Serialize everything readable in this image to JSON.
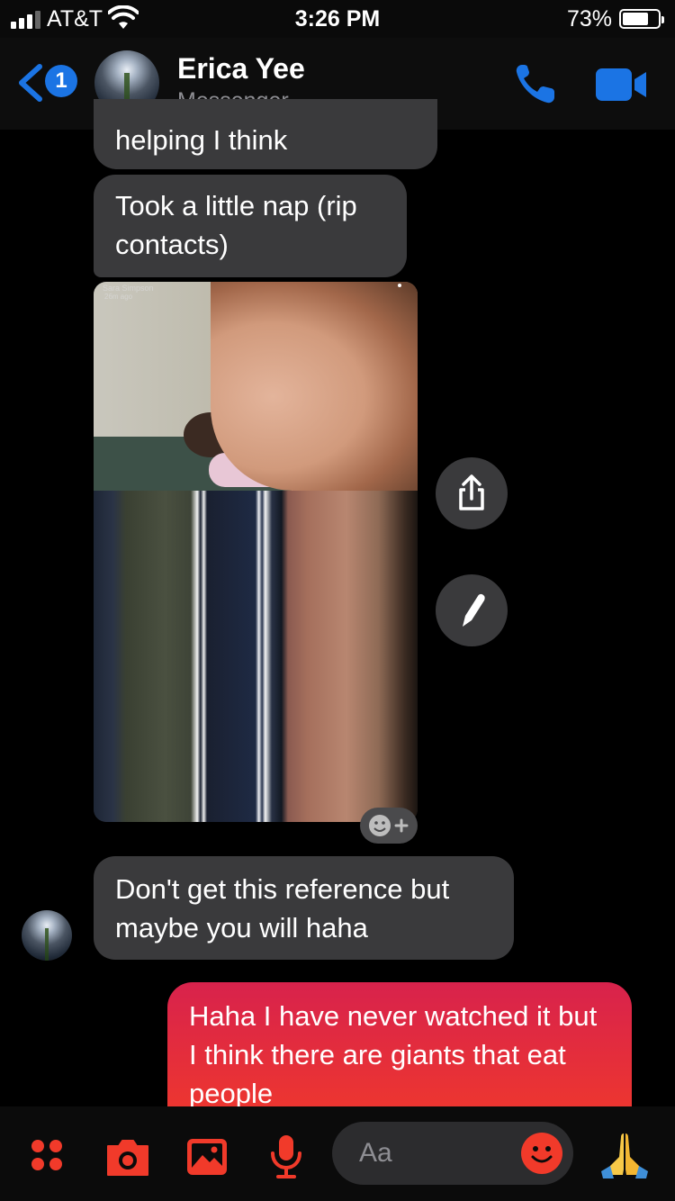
{
  "status_bar": {
    "carrier": "AT&T",
    "time": "3:26 PM",
    "battery": "73%",
    "battery_level": 0.73
  },
  "header": {
    "back_badge": "1",
    "contact_name": "Erica Yee",
    "subtitle": "Messenger"
  },
  "messages": [
    {
      "from": "contact",
      "text": "helping I think"
    },
    {
      "from": "contact",
      "text": "Took a little nap (rip contacts)"
    },
    {
      "from": "contact",
      "type": "photo"
    },
    {
      "from": "contact",
      "text": "Don't get this reference but maybe you will haha"
    },
    {
      "from": "me",
      "text": "Haha I have never watched it but I think there are giants that eat people"
    }
  ],
  "photo_overlay": {
    "caption": "Sara Simpson",
    "time_ago": "26m ago"
  },
  "composer": {
    "placeholder": "Aa"
  },
  "icons": {
    "back": "chevron-left-icon",
    "call": "phone-icon",
    "video": "video-camera-icon",
    "share": "share-icon",
    "edit": "pencil-icon",
    "react": "add-reaction-icon",
    "menu": "four-dots-icon",
    "camera": "camera-icon",
    "gallery": "image-icon",
    "mic": "microphone-icon",
    "emoji": "smiley-icon",
    "quick_reaction": "folded-hands-icon"
  },
  "colors": {
    "accent_blue": "#1b74e4",
    "sent_bubble_top": "#d8224c",
    "sent_bubble_bottom": "#f13a2a",
    "received_bubble": "#3a3a3c",
    "composer_red": "#f13a2a"
  }
}
